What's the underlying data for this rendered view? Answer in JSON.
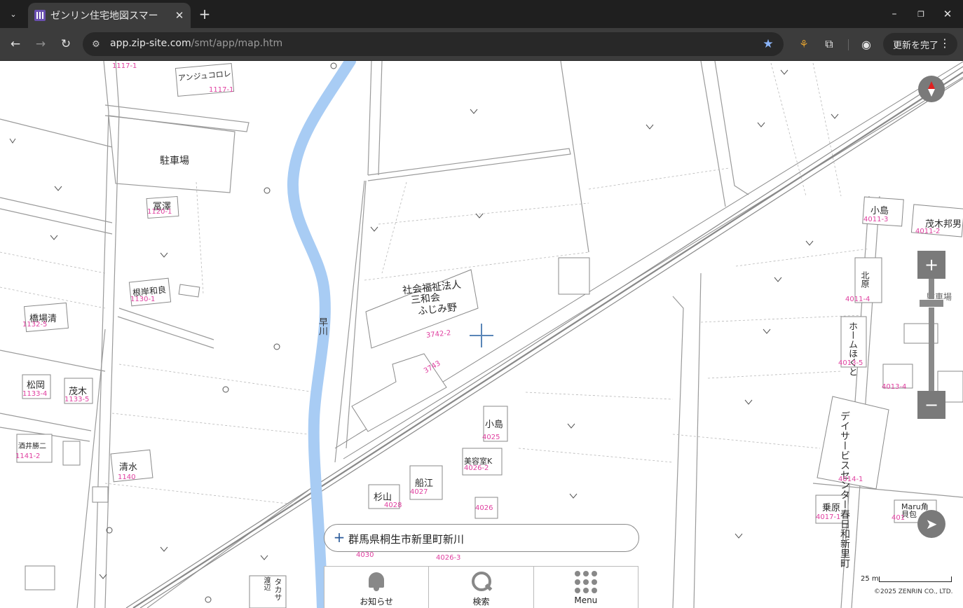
{
  "browser": {
    "tab_title": "ゼンリン住宅地図スマー",
    "url_host": "app.zip-site.com",
    "url_path": "/smt/app/map.htm",
    "update_label": "更新を完了"
  },
  "map": {
    "address": "群馬県桐生市新里町新川",
    "river_name": "早川",
    "labels": {
      "facility_1": "社会福祉法人",
      "facility_2": "三和会",
      "facility_3": "ふじみ野",
      "parking_1": "駐車場",
      "parking_2": "駐車場",
      "tomizawa": "冨澤",
      "negishi": "根岸和良",
      "hashiba": "橋場清",
      "matsuoka": "松岡",
      "mogi": "茂木",
      "mogi_kunio": "茂木邦男",
      "sakai": "酒井勝二",
      "shimizu": "清水",
      "kojima_1": "小島",
      "kojima_2": "小島",
      "biyoshitsu": "美容室K",
      "funae": "船江",
      "sugiyama": "杉山",
      "kitahara": "北原",
      "homecare": "ホームほくと",
      "dayservice": "デイサービスセンター春日和新里町",
      "jouhara": "乗原",
      "maru": "Maru角貝包",
      "angelique": "アンジュコロレ",
      "takaki": "タカサ",
      "watanabe": "渡辺"
    },
    "numbers": {
      "n1": "1117-1",
      "n2": "1117-1",
      "n3": "1120-1",
      "n4": "1130-1",
      "n5": "1132-5",
      "n6": "1133-4",
      "n7": "1133-5",
      "n8": "1141-2",
      "n9": "1140",
      "n10": "3742-2",
      "n11": "3743",
      "n12": "4025",
      "n13": "4026-2",
      "n14": "4027",
      "n15": "4028",
      "n16": "4026",
      "n17": "4011-3",
      "n18": "4011-2",
      "n19": "4011-4",
      "n20": "4013-5",
      "n21": "4013-4",
      "n22": "4014-1",
      "n23": "4017-1",
      "n24": "401",
      "n25": "4030",
      "n26": "4026-3"
    },
    "menu": {
      "notice": "お知らせ",
      "search": "検索",
      "menu": "Menu"
    },
    "scale_label": "25 m",
    "copyright": "©2025 ZENRIN CO., LTD."
  }
}
